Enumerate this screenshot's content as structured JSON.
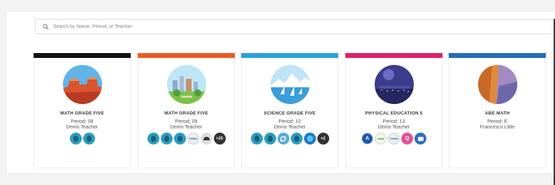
{
  "search": {
    "placeholder": "Search by Name, Period, or Teacher"
  },
  "cards": [
    {
      "title": "MATH GRADE FIVE",
      "period": "Period: 08",
      "teacher": "Demo Teacher",
      "bar_color": "#111111",
      "art": "red-rock-canyon",
      "apps": [
        "brain-app-icon",
        "brain-app-icon"
      ],
      "more": ""
    },
    {
      "title": "MATH GRADE FIVE",
      "period": "Period: 09",
      "teacher": "Demo Teacher",
      "bar_color": "#f05a22",
      "art": "city-park",
      "apps": [
        "brain-app-icon",
        "brain-app-icon",
        "brain-app-icon",
        "think-app-icon",
        "cloud-app-icon"
      ],
      "more": "+25",
      "think_label": "THINK"
    },
    {
      "title": "SCIENCE GRADE FIVE",
      "period": "Period: 10",
      "teacher": "Demo Teacher",
      "bar_color": "#2b9fe2",
      "art": "mountain-lake-sailboats",
      "apps": [
        "brain-app-icon",
        "brain-app-icon",
        "leaf-app-icon",
        "brain-app-icon",
        "globe-app-icon"
      ],
      "more": "+2"
    },
    {
      "title": "PHYSICAL EDUCATION 5",
      "period": "Period: 13",
      "teacher": "Demo Teacher",
      "bar_color": "#e0206b",
      "art": "night-city",
      "apps": [
        "a-app-icon",
        "smart-app-icon",
        "think-app-icon",
        "q-app-icon",
        "chat-app-icon"
      ],
      "more": "",
      "a_label": "A",
      "smart_label": "smart",
      "think_label": "THINK",
      "q_label": "Q"
    },
    {
      "title": "ABE MATH",
      "period": "Period: E",
      "teacher": "Francesco Little",
      "bar_color": "#1f6dbf",
      "art": "desert-cliff",
      "apps": [],
      "more": ""
    }
  ]
}
